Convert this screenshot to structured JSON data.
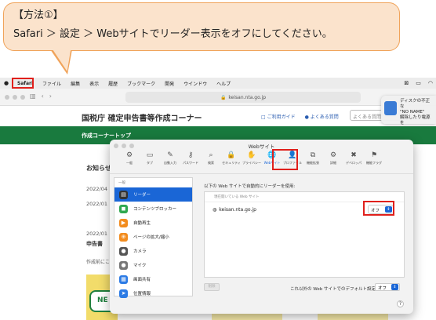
{
  "callout": {
    "title": "【方法①】",
    "text": "Safari ＞ 設定 ＞ Webサイトでリーダー表示をオフにしてください。"
  },
  "menubar": {
    "app": "Safari",
    "items": [
      "ファイル",
      "編集",
      "表示",
      "履歴",
      "ブックマーク",
      "開発",
      "ウインドウ",
      "ヘルプ"
    ]
  },
  "browser": {
    "address": "keisan.nta.go.jp"
  },
  "notification": {
    "line1": "ディスクの不正な",
    "line2": "\"NO NAME\"",
    "line3": "解除したり電源を"
  },
  "site": {
    "title": "国税庁 確定申告書等作成コーナー",
    "guide_link": "ご利用ガイド",
    "faq_link": "よくある質問",
    "search_placeholder": "よくある質問",
    "nav_label": "作成コーナートップ",
    "oshirase": "お知らせ",
    "dates": [
      "2022/04",
      "2022/01",
      "2022/01"
    ],
    "shinkoku": "申告書",
    "sakusei": "作成前にこ",
    "card_letter": "NE"
  },
  "prefs": {
    "window_title": "Webサイト",
    "tabs": [
      {
        "icon": "⚙",
        "label": "一般"
      },
      {
        "icon": "▭",
        "label": "タブ"
      },
      {
        "icon": "✎",
        "label": "自動入力"
      },
      {
        "icon": "⚷",
        "label": "パスワード"
      },
      {
        "icon": "⌕",
        "label": "検索"
      },
      {
        "icon": "🔒",
        "label": "セキュリティ"
      },
      {
        "icon": "✋",
        "label": "プライバシー"
      },
      {
        "icon": "🌐",
        "label": "Webサイト"
      },
      {
        "icon": "👤",
        "label": "プロファイル"
      },
      {
        "icon": "⧉",
        "label": "機能拡張"
      },
      {
        "icon": "⚙",
        "label": "詳細"
      },
      {
        "icon": "✖",
        "label": "デベロッパ"
      },
      {
        "icon": "⚑",
        "label": "機能フラグ"
      }
    ],
    "sidebar_header": "一般",
    "sidebar_items": [
      {
        "label": "リーダー",
        "icon": "▤",
        "color": "#333333"
      },
      {
        "label": "コンテンツブロッカー",
        "icon": "◼",
        "color": "#2fa84f"
      },
      {
        "label": "自動再生",
        "icon": "▶",
        "color": "#f28c1e"
      },
      {
        "label": "ページの拡大/縮小",
        "icon": "⊕",
        "color": "#f28c1e"
      },
      {
        "label": "カメラ",
        "icon": "●",
        "color": "#555555"
      },
      {
        "label": "マイク",
        "icon": "●",
        "color": "#777777"
      },
      {
        "label": "画面共有",
        "icon": "▦",
        "color": "#2c7be5"
      },
      {
        "label": "位置情報",
        "icon": "➤",
        "color": "#2c7be5"
      }
    ],
    "panel_title": "以下の Web サイトで自動的にリーダーを使用:",
    "panel_subhead": "現在開いている Web サイト",
    "site_row": "keisan.nta.go.jp",
    "site_setting": "オフ",
    "remove_button": "削除",
    "default_label": "これ以外の Web サイトでのデフォルト設定:",
    "default_value": "オフ",
    "help": "?"
  }
}
